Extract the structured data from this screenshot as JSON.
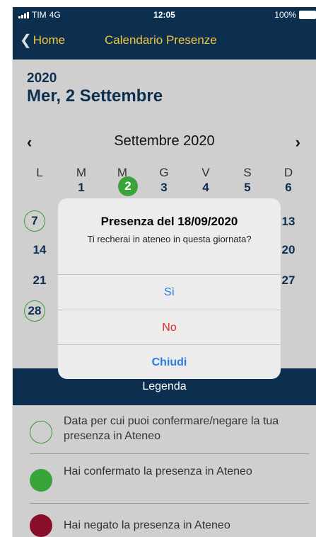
{
  "status_bar": {
    "carrier": "TIM",
    "network": "4G",
    "time": "12:05",
    "battery": "100%"
  },
  "nav": {
    "back_label": "Home",
    "title": "Calendario Presenze"
  },
  "header": {
    "year": "2020",
    "selected_date": "Mer, 2 Settembre"
  },
  "calendar": {
    "month_label": "Settembre 2020",
    "prev_icon": "chevron-left-icon",
    "next_icon": "chevron-right-icon",
    "weekdays": [
      "L",
      "M",
      "M",
      "G",
      "V",
      "S",
      "D"
    ],
    "days": {
      "d1": "1",
      "d2": "2",
      "d3": "3",
      "d4": "4",
      "d5": "5",
      "d6": "6",
      "d7": "7",
      "d13": "13",
      "d14": "14",
      "d20": "20",
      "d21": "21",
      "d27": "27",
      "d28": "28"
    },
    "confirmed_color": "#3aa43a",
    "available_color": "#3a9a3a"
  },
  "dialog": {
    "title": "Presenza del 18/09/2020",
    "message": "Ti recherai in ateneo in questa giornata?",
    "yes_label": "Sì",
    "no_label": "No",
    "close_label": "Chiudi"
  },
  "legend": {
    "title": "Legenda",
    "items": [
      {
        "text": "Data per cui puoi confermare/negare la tua presenza in Ateneo",
        "color": "#3a9a3a"
      },
      {
        "text": "Hai confermato la presenza in Ateneo",
        "color": "#3aa43a"
      },
      {
        "text": "Hai negato la presenza in Ateneo",
        "color": "#8a0e2a"
      }
    ]
  }
}
